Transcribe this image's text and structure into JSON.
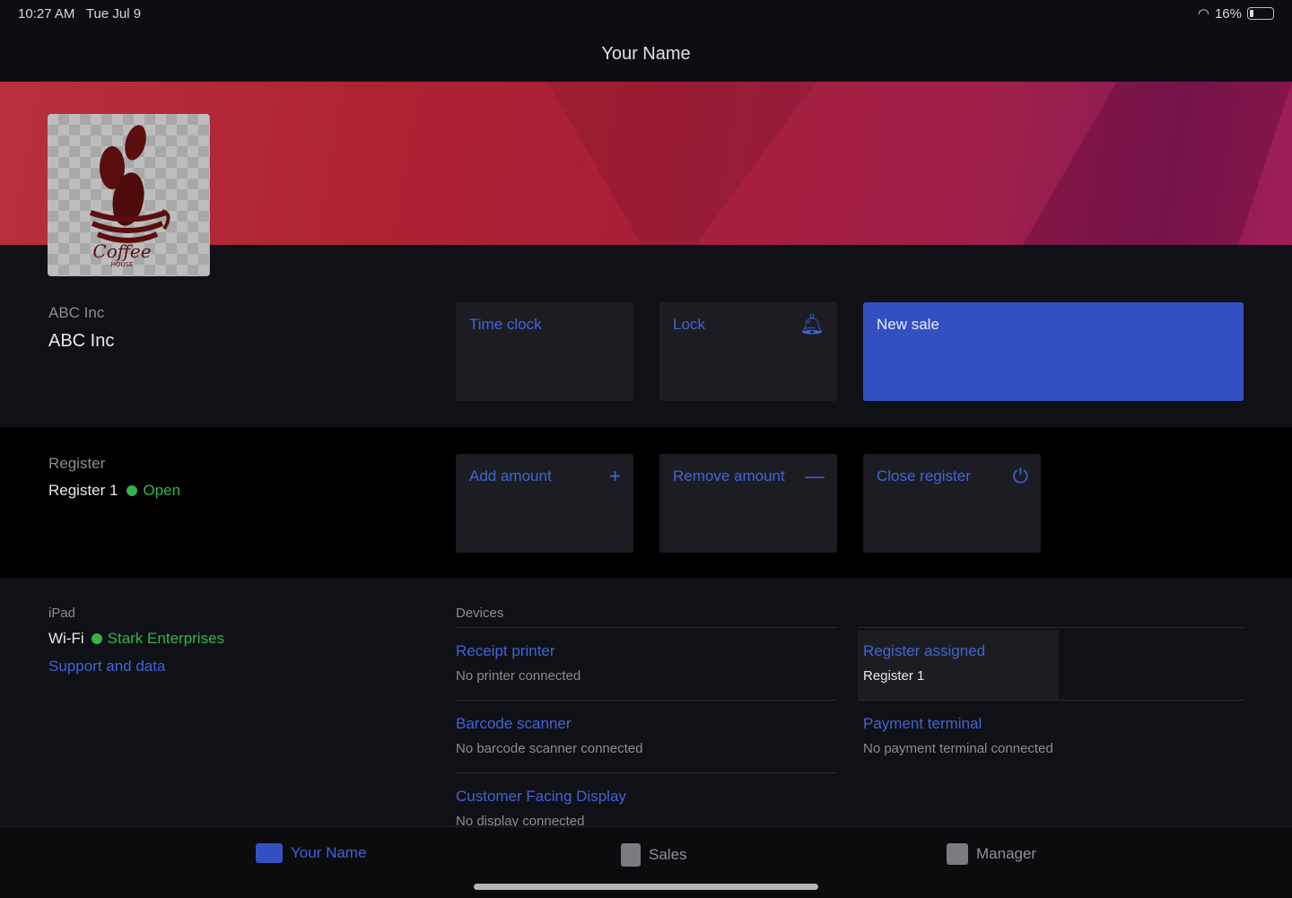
{
  "status": {
    "time": "10:27 AM",
    "date": "Tue Jul 9",
    "battery": "16%"
  },
  "header": {
    "title": "Your Name"
  },
  "logo": {
    "text": "Coffee",
    "subtext": "HOUSE"
  },
  "company": {
    "label": "ABC Inc",
    "name": "ABC Inc"
  },
  "tiles": {
    "time_clock": "Time clock",
    "lock": "Lock",
    "new_sale": "New sale",
    "add_amount": "Add amount",
    "remove_amount": "Remove amount",
    "close_register": "Close register"
  },
  "register": {
    "label": "Register",
    "name": "Register 1",
    "status": "Open"
  },
  "ipad": {
    "label": "iPad",
    "wifi_label": "Wi-Fi",
    "wifi_network": "Stark Enterprises",
    "support": "Support and data"
  },
  "devices": {
    "label": "Devices",
    "items": [
      {
        "title": "Receipt printer",
        "sub": "No printer connected"
      },
      {
        "title": "Register assigned",
        "sub": "Register 1"
      },
      {
        "title": "Barcode scanner",
        "sub": "No barcode scanner connected"
      },
      {
        "title": "Payment terminal",
        "sub": "No payment terminal connected"
      },
      {
        "title": "Customer Facing Display",
        "sub": "No display connected"
      }
    ]
  },
  "tabs": [
    {
      "label": "Your Name",
      "icon": "contact-card-icon",
      "active": true
    },
    {
      "label": "Sales",
      "icon": "clipboard-icon"
    },
    {
      "label": "Manager",
      "icon": "manager-book-icon"
    }
  ],
  "colors": {
    "accent": "#4263d8",
    "open": "#32b54a"
  }
}
